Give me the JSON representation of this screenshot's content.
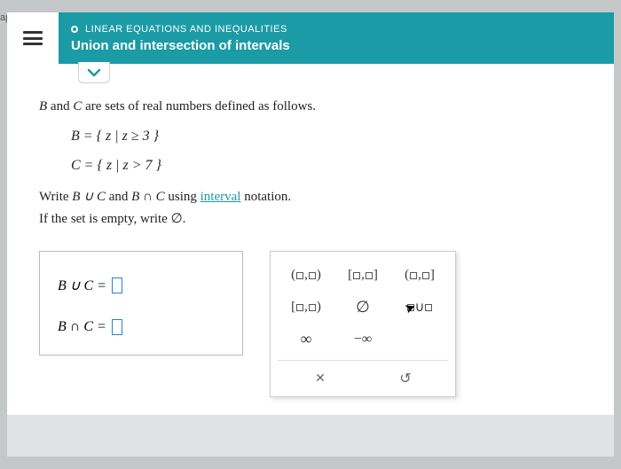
{
  "corner": "aps",
  "header": {
    "category": "LINEAR EQUATIONS AND INEQUALITIES",
    "topic": "Union and intersection of intervals"
  },
  "problem": {
    "intro_pre": "B",
    "intro_mid": " and ",
    "intro_c": "C",
    "intro_post": " are sets of real numbers defined as follows.",
    "setB": "B = { z | z ≥ 3 }",
    "setC": "C = { z | z > 7 }",
    "instr1_a": "Write ",
    "instr1_b": "B ∪ C",
    "instr1_c": " and ",
    "instr1_d": "B ∩ C",
    "instr1_e": " using ",
    "instr1_link": "interval",
    "instr1_f": " notation.",
    "instr2_a": "If the set is ",
    "instr2_link": "empty",
    "instr2_b": ", write ",
    "instr2_sym": "∅",
    "instr2_c": "."
  },
  "answers": {
    "line1": "B  ∪  C  =",
    "line2": "B  ∩  C  ="
  },
  "keypad": {
    "r1": {
      "a": "(□,□)",
      "b": "[□,□]",
      "c": "(□,□]"
    },
    "r2": {
      "a": "[□,□)",
      "b": "∅",
      "c": "□∪□"
    },
    "r3": {
      "a": "∞",
      "b": "−∞",
      "c": ""
    },
    "footer": {
      "x": "✕",
      "reset": "↺"
    }
  }
}
